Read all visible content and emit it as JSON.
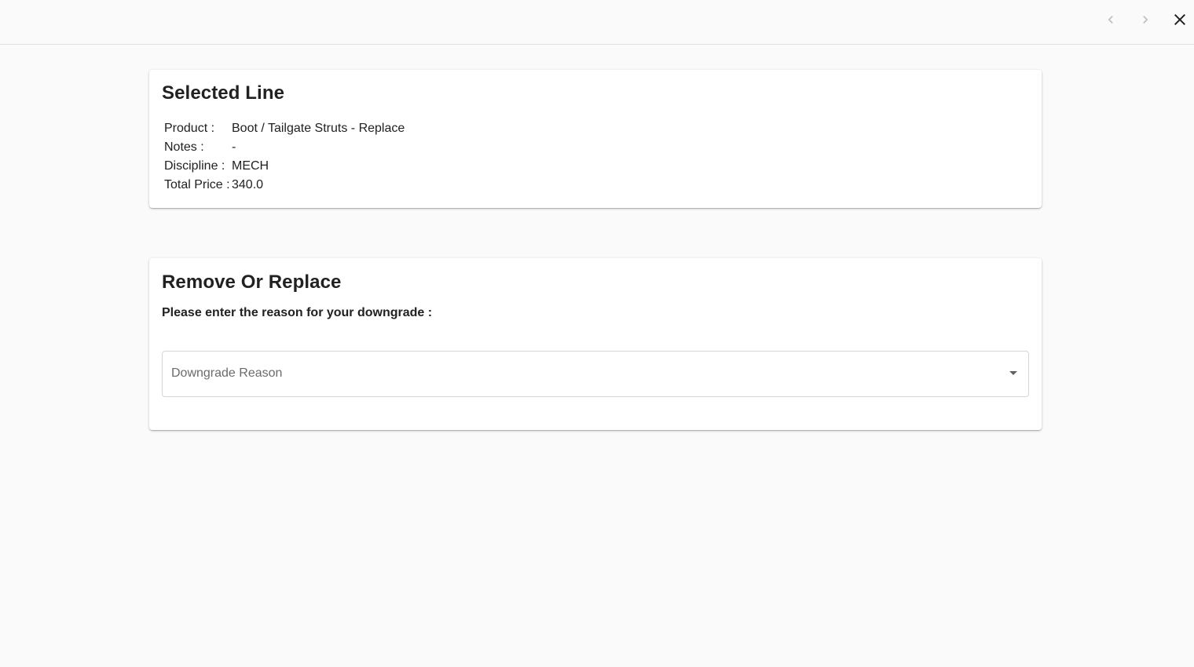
{
  "header": {
    "prev_icon": "chevron-left-icon",
    "next_icon": "chevron-right-icon",
    "close_icon": "close-icon"
  },
  "selected_line": {
    "title": "Selected Line",
    "rows": [
      {
        "label": "Product :",
        "value": "Boot / Tailgate Struts - Replace"
      },
      {
        "label": "Notes :",
        "value": "-"
      },
      {
        "label": "Discipline :",
        "value": "MECH"
      },
      {
        "label": "Total Price :",
        "value": "340.0"
      }
    ]
  },
  "remove_or_replace": {
    "title": "Remove Or Replace",
    "prompt": "Please enter the reason for your downgrade :",
    "downgrade_select": {
      "placeholder": "Downgrade Reason",
      "value": ""
    }
  },
  "colors": {
    "background": "#fafafa",
    "card": "#ffffff",
    "text": "#212121",
    "placeholder": "#6b6b6b",
    "icon_disabled": "#bdbdbd",
    "icon_active": "#212121"
  }
}
